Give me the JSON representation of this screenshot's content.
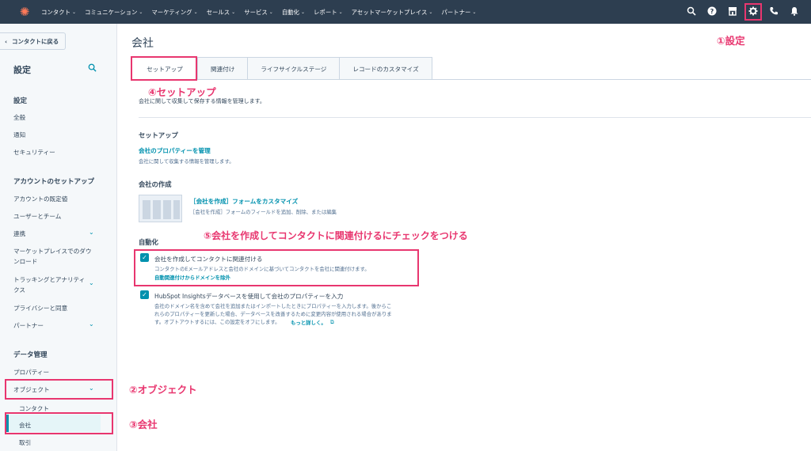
{
  "topnav": {
    "items": [
      "コンタクト",
      "コミュニケーション",
      "マーケティング",
      "セールス",
      "サービス",
      "自動化",
      "レポート",
      "アセットマーケットプレイス",
      "パートナー"
    ],
    "icons": [
      "search-icon",
      "help-icon",
      "marketplace-icon",
      "settings-icon",
      "calling-icon",
      "notifications-icon"
    ]
  },
  "sidebar": {
    "back_label": "コンタクトに戻る",
    "title": "設定",
    "sections": {
      "settings": "設定",
      "account_setup": "アカウントのセットアップ",
      "data_management": "データ管理"
    },
    "items": {
      "general": "全般",
      "notifications": "通知",
      "security": "セキュリティー",
      "account_defaults": "アカウントの既定値",
      "users_teams": "ユーザーとチーム",
      "integrations": "連携",
      "marketplace_downloads": "マーケットプレイスでのダウンロード",
      "tracking_analytics": "トラッキングとアナリティクス",
      "privacy_consent": "プライバシーと同意",
      "partner": "パートナー",
      "properties": "プロパティー",
      "objects": "オブジェクト",
      "contacts": "コンタクト",
      "companies": "会社",
      "deals": "取引"
    }
  },
  "main": {
    "title": "会社",
    "tabs": [
      "セットアップ",
      "関連付け",
      "ライフサイクルステージ",
      "レコードのカスタマイズ"
    ],
    "description": "会社に関して収集して保存する情報を管理します。",
    "setup": {
      "heading": "セットアップ",
      "link": "会社のプロパティーを管理",
      "desc": "会社に関して収集する情報を管理します。"
    },
    "create": {
      "heading": "会社の作成",
      "link": "［会社を作成］フォームをカスタマイズ",
      "desc": "［会社を作成］フォームのフィールドを追加、削除、または編集"
    },
    "automation": {
      "heading": "自動化",
      "option1_label": "会社を作成してコンタクトに関連付ける",
      "option1_desc": "コンタクトのEメールアドレスと会社のドメインに基づいてコンタクトを会社に関連付けます。",
      "option1_link": "自動関連付けからドメインを除外",
      "option2_label": "HubSpot Insightsデータベースを使用して会社のプロパティーを入力",
      "option2_desc_1": "会社のドメイン名を含めて会社を追加またはインポートしたときにプロパティーを入力します。後からこ",
      "option2_desc_2": "れらのプロパティーを更新した場合、データベースを改善するために変更内容が使用される場合がありま",
      "option2_desc_3": "す。オプトアウトするには、この設定をオフにします。",
      "option2_link": "もっと詳しく。"
    }
  },
  "annotations": {
    "a1": "①設定",
    "a2": "②オブジェクト",
    "a3": "③会社",
    "a4": "④セットアップ",
    "a5": "⑤会社を作成してコンタクトに関連付けるにチェックをつける"
  },
  "colors": {
    "nav_bg": "#2d3e50",
    "accent": "#0091ae",
    "annotation": "#e8366f",
    "brand": "#ff7a59"
  }
}
